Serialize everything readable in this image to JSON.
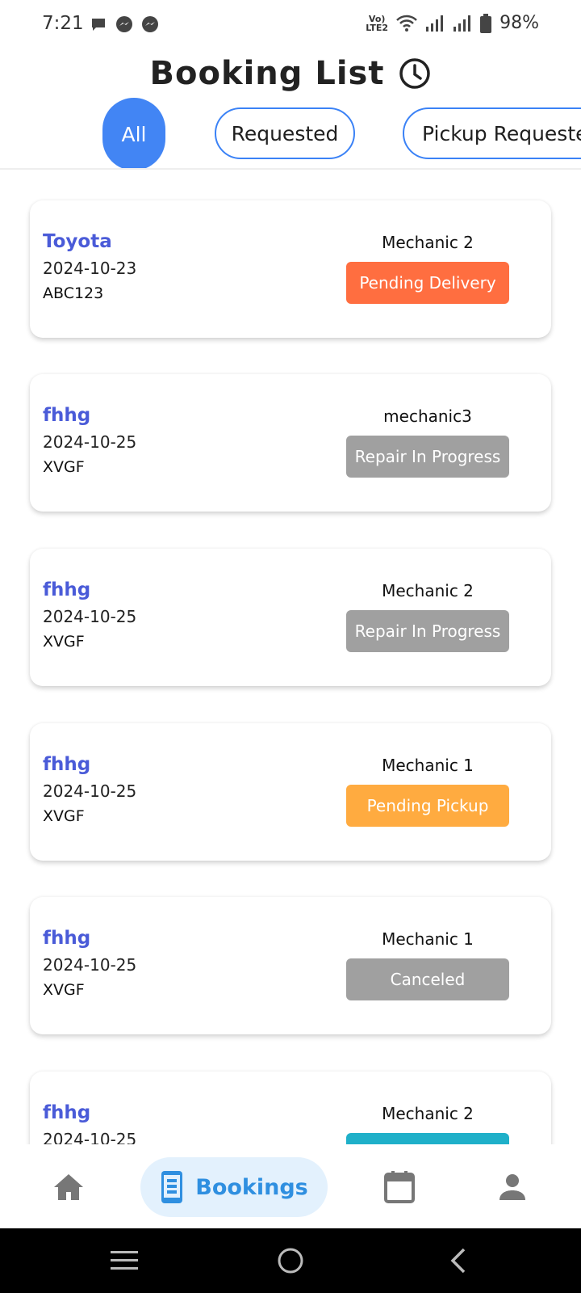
{
  "status_bar": {
    "time": "7:21",
    "network_label": "VoLTE2",
    "battery": "98%",
    "notification_icons": [
      "chat-bubble-icon",
      "messenger-icon",
      "messenger-icon"
    ]
  },
  "header": {
    "title": "Booking List",
    "icon": "clock-icon"
  },
  "tabs": [
    {
      "label": "All",
      "active": true
    },
    {
      "label": "Requested",
      "active": false
    },
    {
      "label": "Pickup Requeste",
      "active": false
    }
  ],
  "bookings": [
    {
      "car": "Toyota",
      "date": "2024-10-23",
      "plate": "ABC123",
      "mechanic": "Mechanic 2",
      "status": "Pending Delivery",
      "status_color": "#ff6e40"
    },
    {
      "car": "fhhg",
      "date": "2024-10-25",
      "plate": "XVGF",
      "mechanic": "mechanic3",
      "status": "Repair In Progress",
      "status_color": "#a0a0a0"
    },
    {
      "car": "fhhg",
      "date": "2024-10-25",
      "plate": "XVGF",
      "mechanic": "Mechanic 2",
      "status": "Repair In Progress",
      "status_color": "#a0a0a0"
    },
    {
      "car": "fhhg",
      "date": "2024-10-25",
      "plate": "XVGF",
      "mechanic": "Mechanic 1",
      "status": "Pending Pickup",
      "status_color": "#ffab40"
    },
    {
      "car": "fhhg",
      "date": "2024-10-25",
      "plate": "XVGF",
      "mechanic": "Mechanic 1",
      "status": "Canceled",
      "status_color": "#a0a0a0"
    },
    {
      "car": "fhhg",
      "date": "2024-10-25",
      "plate": "",
      "mechanic": "Mechanic 2",
      "status": "",
      "status_color": "#1fb0c9"
    }
  ],
  "bottom_nav": {
    "items": [
      {
        "icon": "home-icon",
        "label": ""
      },
      {
        "icon": "booking-phone-icon",
        "label": "Bookings",
        "active": true
      },
      {
        "icon": "calendar-icon",
        "label": ""
      },
      {
        "icon": "person-icon",
        "label": ""
      }
    ]
  },
  "system_nav": [
    "menu-icon",
    "home-circle-icon",
    "back-icon"
  ],
  "colors": {
    "accent": "#4285f4",
    "car_name": "#4a5bd8",
    "nav_active_bg": "#e3f1fd",
    "nav_active_fg": "#2f8fe0"
  }
}
